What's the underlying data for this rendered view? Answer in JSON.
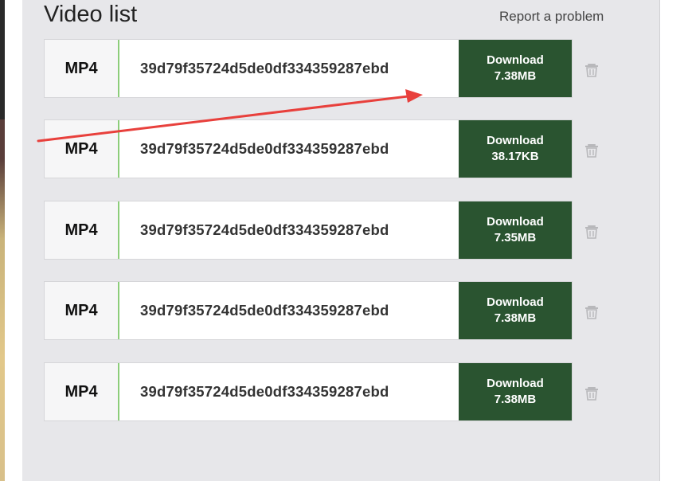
{
  "header": {
    "title": "Video list",
    "report_link": "Report a problem"
  },
  "videos": [
    {
      "format": "MP4",
      "filename": "39d79f35724d5de0df334359287ebd",
      "download_label": "Download",
      "size": "7.38MB"
    },
    {
      "format": "MP4",
      "filename": "39d79f35724d5de0df334359287ebd",
      "download_label": "Download",
      "size": "38.17KB"
    },
    {
      "format": "MP4",
      "filename": "39d79f35724d5de0df334359287ebd",
      "download_label": "Download",
      "size": "7.35MB"
    },
    {
      "format": "MP4",
      "filename": "39d79f35724d5de0df334359287ebd",
      "download_label": "Download",
      "size": "7.38MB"
    },
    {
      "format": "MP4",
      "filename": "39d79f35724d5de0df334359287ebd",
      "download_label": "Download",
      "size": "7.38MB"
    }
  ],
  "colors": {
    "download_button": "#2a5430",
    "panel_background": "#e7e7ea",
    "format_divider": "#8ccd7a",
    "annotation_arrow": "#e8403c",
    "trash_icon": "#b8b8bb"
  },
  "icons": {
    "delete": "trash-icon",
    "annotation": "red-arrow-annotation"
  }
}
